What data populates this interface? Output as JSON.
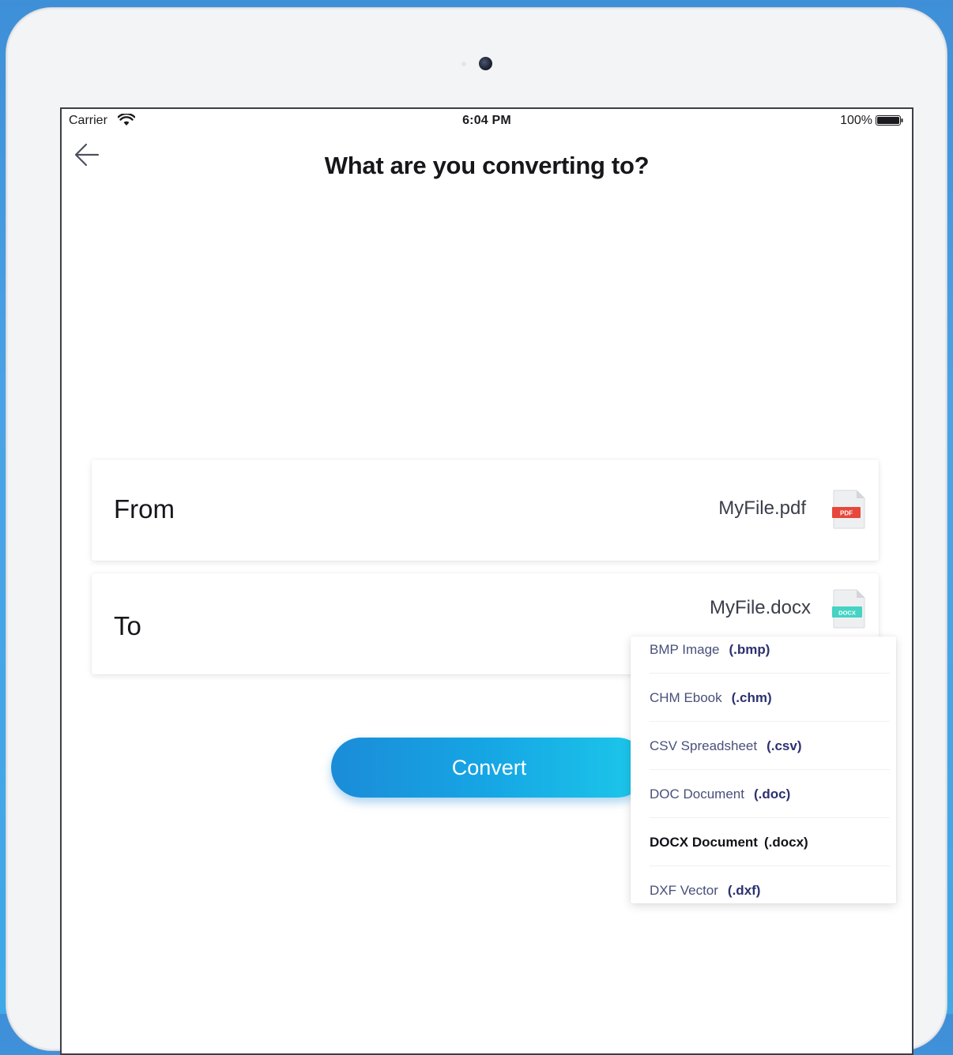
{
  "status_bar": {
    "carrier": "Carrier",
    "time": "6:04 PM",
    "battery": "100%"
  },
  "header": {
    "title": "What are you converting to?"
  },
  "from": {
    "label": "From",
    "file_name": "MyFile.pdf",
    "icon_label": "PDF"
  },
  "to": {
    "label": "To",
    "file_name": "MyFile.docx",
    "icon_label": "DOCX"
  },
  "convert_button": {
    "label": "Convert"
  },
  "dropdown": {
    "items": [
      {
        "name": "BMP Image",
        "ext": "(.bmp)"
      },
      {
        "name": "CHM Ebook",
        "ext": "(.chm)"
      },
      {
        "name": "CSV Spreadsheet",
        "ext": "(.csv)"
      },
      {
        "name": "DOC Document",
        "ext": "(.doc)"
      },
      {
        "name": "DOCX Document",
        "ext": "(.docx)"
      },
      {
        "name": "DXF Vector",
        "ext": "(.dxf)"
      }
    ],
    "selected_index": 4
  },
  "colors": {
    "accent_start": "#1b8cd8",
    "accent_end": "#1cc8ea",
    "pdf_red": "#e6473b",
    "docx_teal": "#45d3c3"
  }
}
